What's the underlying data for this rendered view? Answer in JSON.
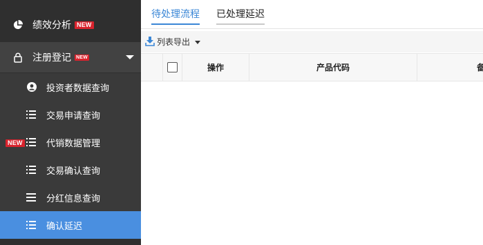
{
  "sidebar": {
    "top_item": {
      "label": "绩效分析",
      "badge": "NEW",
      "icon": "pie-chart-icon"
    },
    "group": {
      "label": "注册登记",
      "badge": "NEW",
      "icon": "lock-icon",
      "expanded": true
    },
    "sub_items": [
      {
        "label": "投资者数据查询",
        "icon": "user-circle-icon",
        "active": false,
        "badge": ""
      },
      {
        "label": "交易申请查询",
        "icon": "list-icon",
        "active": false,
        "badge": ""
      },
      {
        "label": "代销数据管理",
        "icon": "list-icon",
        "active": false,
        "badge": "NEW"
      },
      {
        "label": "交易确认查询",
        "icon": "list-icon",
        "active": false,
        "badge": ""
      },
      {
        "label": "分红信息查询",
        "icon": "menu-icon",
        "active": false,
        "badge": ""
      },
      {
        "label": "确认延迟",
        "icon": "list-icon",
        "active": true,
        "badge": ""
      }
    ]
  },
  "tabs": [
    {
      "label": "待处理流程",
      "active": true
    },
    {
      "label": "已处理延迟",
      "active": false
    }
  ],
  "toolbar": {
    "export_label": "列表导出",
    "export_icon": "download-icon"
  },
  "table": {
    "columns": [
      "",
      "",
      "操作",
      "产品代码",
      "备"
    ]
  },
  "colors": {
    "sidebar_bg": "#2f2f2f",
    "active_item": "#4a8fe0",
    "accent": "#3a86d6",
    "badge": "#d9232d"
  }
}
